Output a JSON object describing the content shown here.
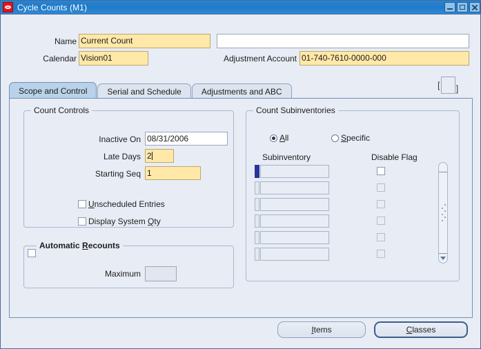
{
  "window": {
    "title": "Cycle Counts (M1)",
    "icon": "oracle-logo-icon",
    "controls": {
      "minimize": "minimize-icon",
      "maximize": "maximize-icon",
      "close": "close-icon"
    }
  },
  "header": {
    "name_label": "Name",
    "name_value": "Current Count",
    "description_value": "",
    "calendar_label": "Calendar",
    "calendar_value": "Vision01",
    "adjustment_account_label": "Adjustment Account",
    "adjustment_account_value": "01-740-7610-0000-000",
    "flexfield_open": "[",
    "flexfield_close": "]",
    "flexfield_value": ""
  },
  "tabs": [
    {
      "label": "Scope and Control",
      "active": true
    },
    {
      "label": "Serial and Schedule",
      "active": false
    },
    {
      "label": "Adjustments and ABC",
      "active": false
    }
  ],
  "count_controls": {
    "group_label": "Count Controls",
    "inactive_on_label": "Inactive On",
    "inactive_on_value": "08/31/2006",
    "late_days_label": "Late Days",
    "late_days_value": "2",
    "starting_seq_label": "Starting Seq",
    "starting_seq_value": "1",
    "unscheduled_entries_label": "Unscheduled Entries",
    "unscheduled_entries_mnemonic": "U",
    "unscheduled_entries_checked": false,
    "display_system_qty_label": "Display System Qty",
    "display_system_qty_mnemonic": "Q",
    "display_system_qty_checked": false
  },
  "automatic_recounts": {
    "group_label": "Automatic Recounts",
    "group_mnemonic": "R",
    "checked": false,
    "maximum_label": "Maximum",
    "maximum_value": ""
  },
  "count_subinventories": {
    "group_label": "Count Subinventories",
    "scope_options": [
      {
        "label": "All",
        "mnemonic": "A",
        "selected": true
      },
      {
        "label": "Specific",
        "mnemonic": "S",
        "selected": false
      }
    ],
    "columns": [
      "Subinventory",
      "Disable Flag"
    ],
    "rows": [
      {
        "subinventory": "",
        "disable_flag": false,
        "current": true
      },
      {
        "subinventory": "",
        "disable_flag": false,
        "current": false
      },
      {
        "subinventory": "",
        "disable_flag": false,
        "current": false
      },
      {
        "subinventory": "",
        "disable_flag": false,
        "current": false
      },
      {
        "subinventory": "",
        "disable_flag": false,
        "current": false
      },
      {
        "subinventory": "",
        "disable_flag": false,
        "current": false
      }
    ]
  },
  "footer": {
    "items_label": "Items",
    "items_mnemonic": "I",
    "classes_label": "Classes",
    "classes_mnemonic": "C",
    "classes_focused": true
  },
  "colors": {
    "titlebar": "#2a84d2",
    "required_field": "#ffe8a8",
    "canvas": "#e8ecf5",
    "active_tab": "#b9d2ea",
    "current_record": "#27369b"
  }
}
